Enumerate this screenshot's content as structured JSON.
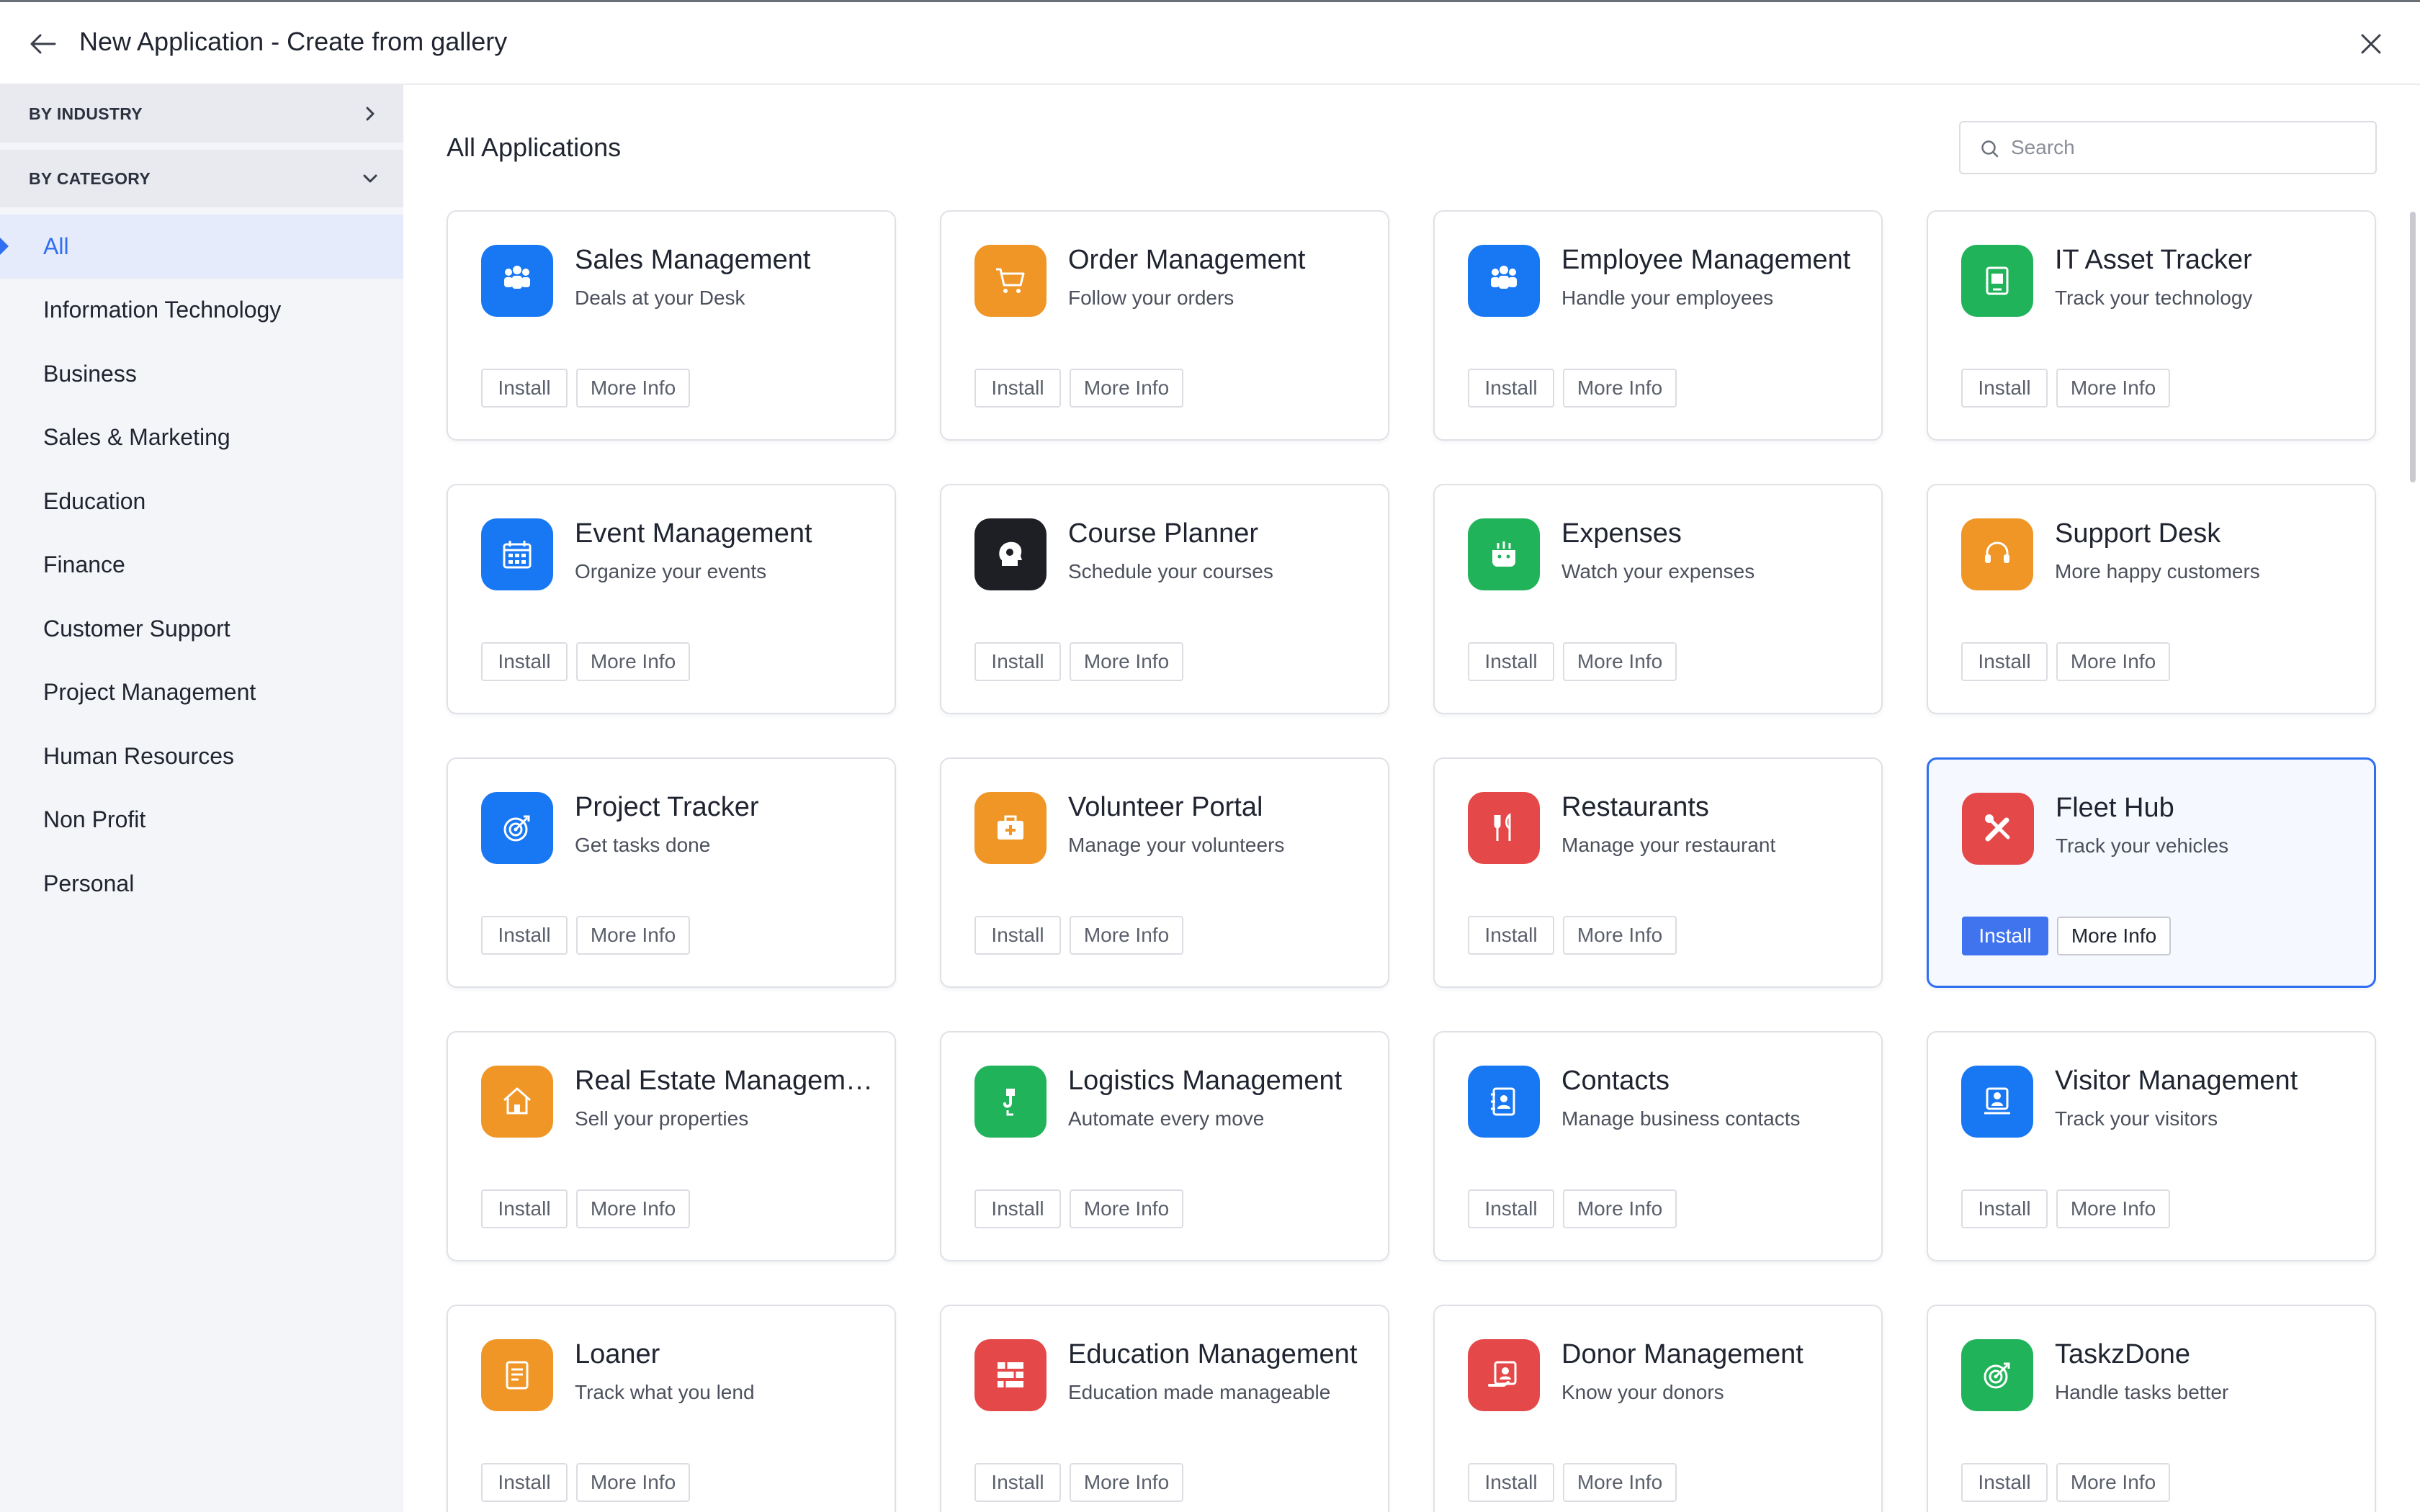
{
  "header": {
    "title": "New Application - Create from gallery",
    "back_icon": "arrow-left-icon",
    "close_icon": "close-icon"
  },
  "sidebar": {
    "by_industry": "BY INDUSTRY",
    "by_category": "BY CATEGORY",
    "categories": [
      "All",
      "Information Technology",
      "Business",
      "Sales & Marketing",
      "Education",
      "Finance",
      "Customer Support",
      "Project Management",
      "Human Resources",
      "Non Profit",
      "Personal"
    ],
    "active_category": "All",
    "accent_color": "#2f6ff0"
  },
  "main": {
    "section_title": "All Applications",
    "search_placeholder": "Search",
    "install_label": "Install",
    "more_info_label": "More Info",
    "apps": [
      {
        "title": "Sales Management",
        "desc": "Deals at your Desk",
        "icon": "people-icon",
        "color": "#1877f2"
      },
      {
        "title": "Order Management",
        "desc": "Follow your orders",
        "icon": "cart-icon",
        "color": "#ef9626"
      },
      {
        "title": "Employee Management",
        "desc": "Handle your employees",
        "icon": "people-icon",
        "color": "#1877f2"
      },
      {
        "title": "IT Asset Tracker",
        "desc": "Track your technology",
        "icon": "device-icon",
        "color": "#21b35a"
      },
      {
        "title": "Event Management",
        "desc": "Organize your events",
        "icon": "calendar-icon",
        "color": "#1877f2"
      },
      {
        "title": "Course Planner",
        "desc": "Schedule your courses",
        "icon": "head-icon",
        "color": "#1d1f24"
      },
      {
        "title": "Expenses",
        "desc": "Watch your expenses",
        "icon": "wallet-icon",
        "color": "#21b35a"
      },
      {
        "title": "Support Desk",
        "desc": "More happy customers",
        "icon": "headset-icon",
        "color": "#ef9626"
      },
      {
        "title": "Project Tracker",
        "desc": "Get tasks done",
        "icon": "target-icon",
        "color": "#1877f2"
      },
      {
        "title": "Volunteer Portal",
        "desc": "Manage your volunteers",
        "icon": "medkit-icon",
        "color": "#ef9626"
      },
      {
        "title": "Restaurants",
        "desc": "Manage your restaurant",
        "icon": "cutlery-icon",
        "color": "#e54848"
      },
      {
        "title": "Fleet Hub",
        "desc": "Track your vehicles",
        "icon": "tools-icon",
        "color": "#e54848",
        "selected": true
      },
      {
        "title": "Real Estate Management",
        "desc": "Sell your properties",
        "icon": "house-icon",
        "color": "#ef9626"
      },
      {
        "title": "Logistics Management",
        "desc": "Automate every move",
        "icon": "hook-icon",
        "color": "#21b35a"
      },
      {
        "title": "Contacts",
        "desc": "Manage business contacts",
        "icon": "contact-book-icon",
        "color": "#1877f2"
      },
      {
        "title": "Visitor Management",
        "desc": "Track your visitors",
        "icon": "visitor-icon",
        "color": "#1877f2"
      },
      {
        "title": "Loaner",
        "desc": "Track what you lend",
        "icon": "document-icon",
        "color": "#ef9626"
      },
      {
        "title": "Education Management",
        "desc": "Education made manageable",
        "icon": "books-icon",
        "color": "#e54848"
      },
      {
        "title": "Donor Management",
        "desc": "Know your donors",
        "icon": "donor-icon",
        "color": "#e54848"
      },
      {
        "title": "TaskzDone",
        "desc": "Handle tasks better",
        "icon": "target-icon",
        "color": "#21b35a"
      }
    ]
  }
}
